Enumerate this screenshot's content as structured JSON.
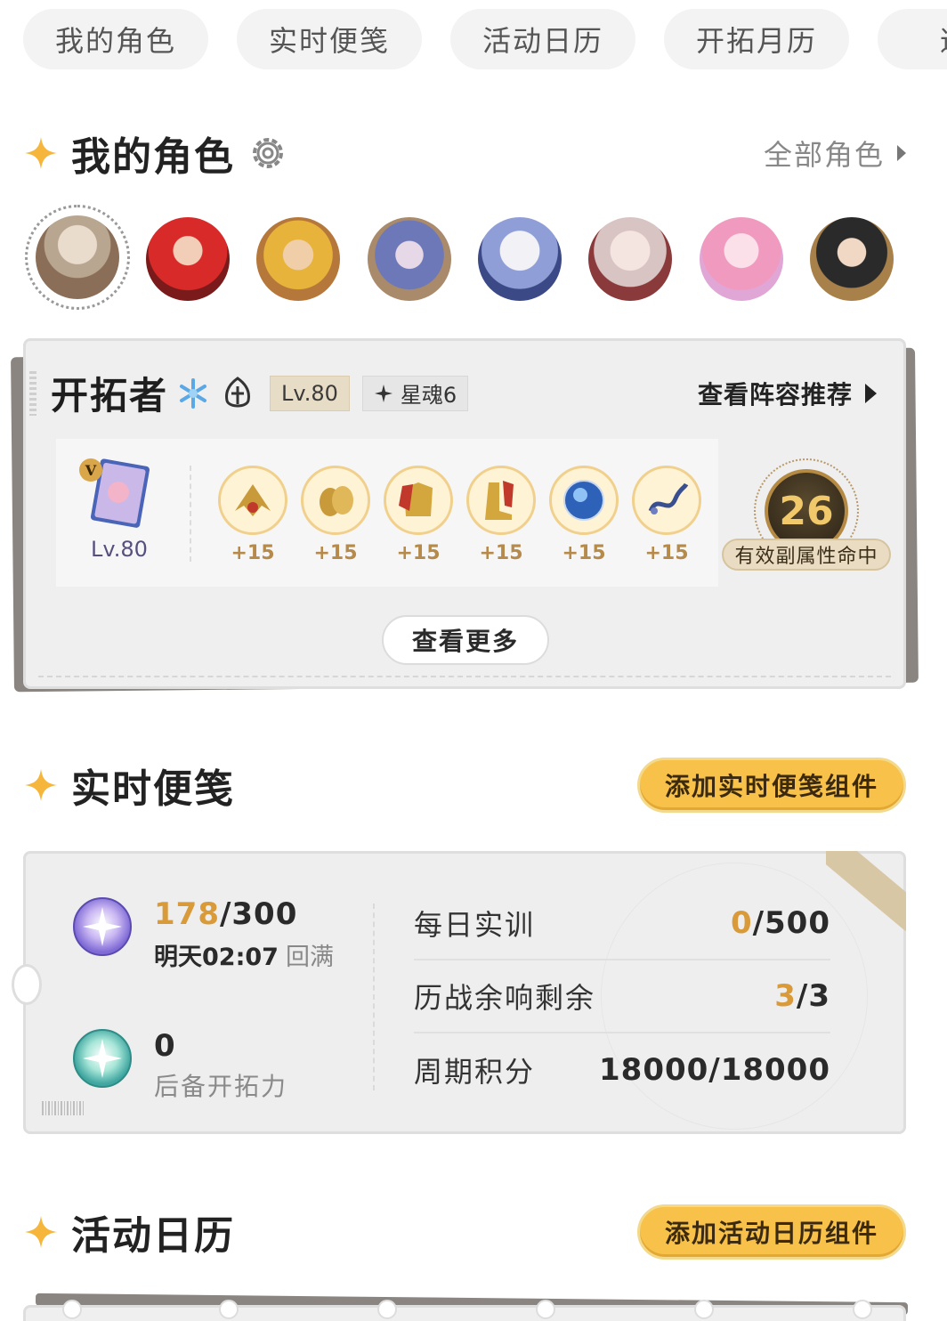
{
  "tabs": [
    "我的角色",
    "实时便笺",
    "活动日历",
    "开拓月历",
    "逐光"
  ],
  "my_characters": {
    "title": "我的角色",
    "all_link": "全部角色",
    "selected": {
      "name": "开拓者",
      "element": "ice",
      "level_tag": "Lv.80",
      "eidolon_tag": "星魂6",
      "lineup_link": "查看阵容推荐",
      "lightcone": {
        "badge": "V",
        "level": "Lv.80"
      },
      "relics": [
        {
          "icon": "relic-hands-icon",
          "level": "+15"
        },
        {
          "icon": "relic-gloves-icon",
          "level": "+15"
        },
        {
          "icon": "relic-body-icon",
          "level": "+15"
        },
        {
          "icon": "relic-feet-icon",
          "level": "+15"
        },
        {
          "icon": "relic-sphere-icon",
          "level": "+15"
        },
        {
          "icon": "relic-rope-icon",
          "level": "+15"
        }
      ],
      "substat_hits": "26",
      "substat_label": "有效副属性命中",
      "more_button": "查看更多"
    }
  },
  "notes": {
    "title": "实时便笺",
    "add_button": "添加实时便笺组件",
    "power_current": "178",
    "power_max": "/300",
    "refill_time": "明天02:07",
    "refill_label": "回满",
    "reserve_value": "0",
    "reserve_label": "后备开拓力",
    "stats": [
      {
        "name": "每日实训",
        "hi": "0",
        "rest": "/500"
      },
      {
        "name": "历战余响剩余",
        "hi": "3",
        "rest": "/3"
      },
      {
        "name": "周期积分",
        "hi": "",
        "rest": "18000/18000"
      }
    ]
  },
  "calendar": {
    "title": "活动日历",
    "add_button": "添加活动日历组件"
  },
  "colors": {
    "accent": "#f7c14a",
    "highlight": "#d99a3a"
  }
}
